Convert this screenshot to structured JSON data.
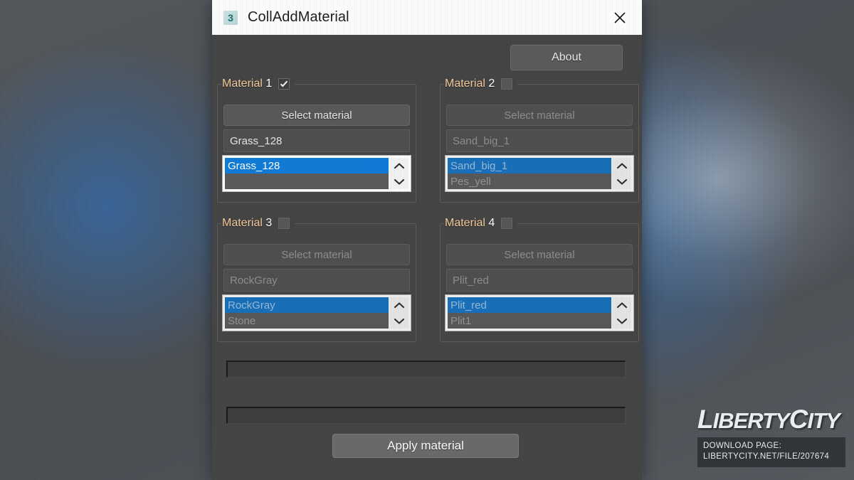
{
  "window": {
    "title": "CollAddMaterial",
    "icon": "max-script-icon",
    "close_label": "✕"
  },
  "toolbar": {
    "about_label": "About"
  },
  "groups": [
    {
      "label_prefix": "Material",
      "number": "1",
      "checked": true,
      "enabled": true,
      "select_button": "Select material",
      "field_value": "Grass_128",
      "list": [
        "Grass_128",
        ""
      ],
      "selected_index": 0
    },
    {
      "label_prefix": "Material",
      "number": "2",
      "checked": false,
      "enabled": false,
      "select_button": "Select material",
      "field_value": "Sand_big_1",
      "list": [
        "Sand_big_1",
        "Pes_yell"
      ],
      "selected_index": 0
    },
    {
      "label_prefix": "Material",
      "number": "3",
      "checked": false,
      "enabled": false,
      "select_button": "Select material",
      "field_value": "RockGray",
      "list": [
        "RockGray",
        "Stone"
      ],
      "selected_index": 0
    },
    {
      "label_prefix": "Material",
      "number": "4",
      "checked": false,
      "enabled": false,
      "select_button": "Select material",
      "field_value": "Plit_red",
      "list": [
        "Plit_red",
        "Plit1"
      ],
      "selected_index": 0
    }
  ],
  "progress": [
    {
      "name": "progress-bar-1",
      "value": 0
    },
    {
      "name": "progress-bar-2",
      "value": 0
    }
  ],
  "footer": {
    "apply_label": "Apply material"
  },
  "watermark": {
    "logo_liberty": "IBERTY",
    "logo_city": "ITY",
    "cap_l": "L",
    "cap_c": "C",
    "download_label": "DOWNLOAD PAGE:",
    "download_url": "LIBERTYCITY.NET/FILE/207674"
  },
  "colors": {
    "accent_selection": "#0f7bd8",
    "window_client": "#444444",
    "titlebar": "#ffffff",
    "group_label": "#f0c79a"
  }
}
